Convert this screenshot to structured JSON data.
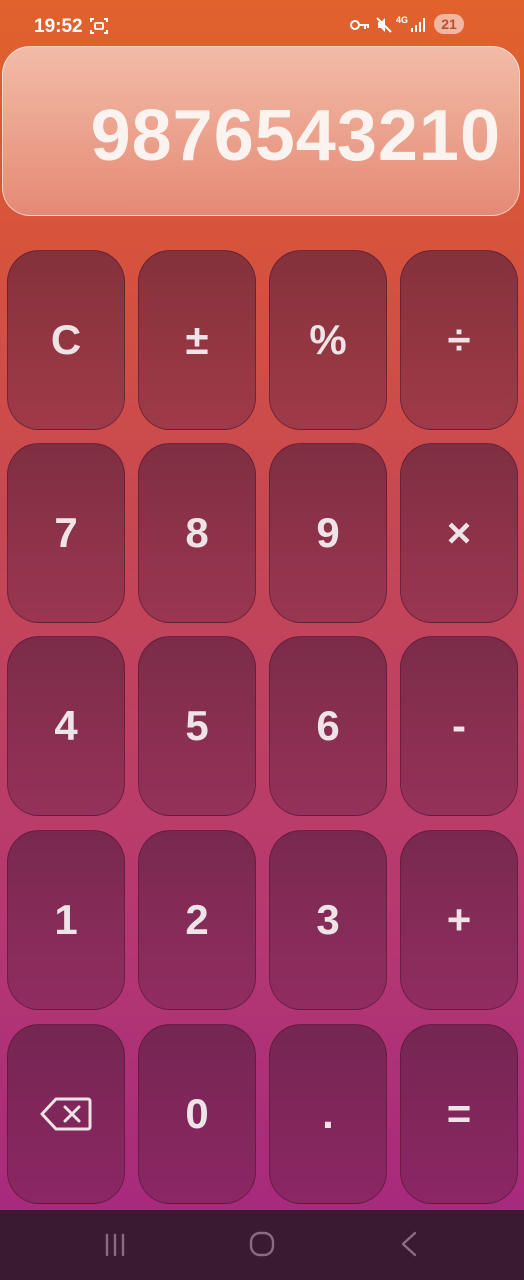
{
  "status_bar": {
    "time": "19:52",
    "network": "4G",
    "battery": "21",
    "icons": [
      "screen-record-icon",
      "vpn-key-icon",
      "mute-icon",
      "signal-icon"
    ]
  },
  "display": {
    "value": "9876543210"
  },
  "keypad": {
    "rows": [
      [
        {
          "label": "C",
          "name": "clear-button"
        },
        {
          "label": "±",
          "name": "plus-minus-button"
        },
        {
          "label": "%",
          "name": "percent-button"
        },
        {
          "label": "÷",
          "name": "divide-button"
        }
      ],
      [
        {
          "label": "7",
          "name": "digit-7-button"
        },
        {
          "label": "8",
          "name": "digit-8-button"
        },
        {
          "label": "9",
          "name": "digit-9-button"
        },
        {
          "label": "×",
          "name": "multiply-button"
        }
      ],
      [
        {
          "label": "4",
          "name": "digit-4-button"
        },
        {
          "label": "5",
          "name": "digit-5-button"
        },
        {
          "label": "6",
          "name": "digit-6-button"
        },
        {
          "label": "-",
          "name": "subtract-button"
        }
      ],
      [
        {
          "label": "1",
          "name": "digit-1-button"
        },
        {
          "label": "2",
          "name": "digit-2-button"
        },
        {
          "label": "3",
          "name": "digit-3-button"
        },
        {
          "label": "+",
          "name": "add-button"
        }
      ],
      [
        {
          "label": "",
          "name": "backspace-button",
          "icon": "backspace-icon"
        },
        {
          "label": "0",
          "name": "digit-0-button"
        },
        {
          "label": ".",
          "name": "decimal-button"
        },
        {
          "label": "=",
          "name": "equals-button"
        }
      ]
    ]
  },
  "nav_bar": {
    "icons": [
      "recents-icon",
      "home-icon",
      "back-icon"
    ]
  },
  "colors": {
    "gradient_top": "#e1622c",
    "gradient_bottom": "#a82a7c",
    "key_text": "#eee3e6",
    "nav_bar": "#3a1a33"
  }
}
